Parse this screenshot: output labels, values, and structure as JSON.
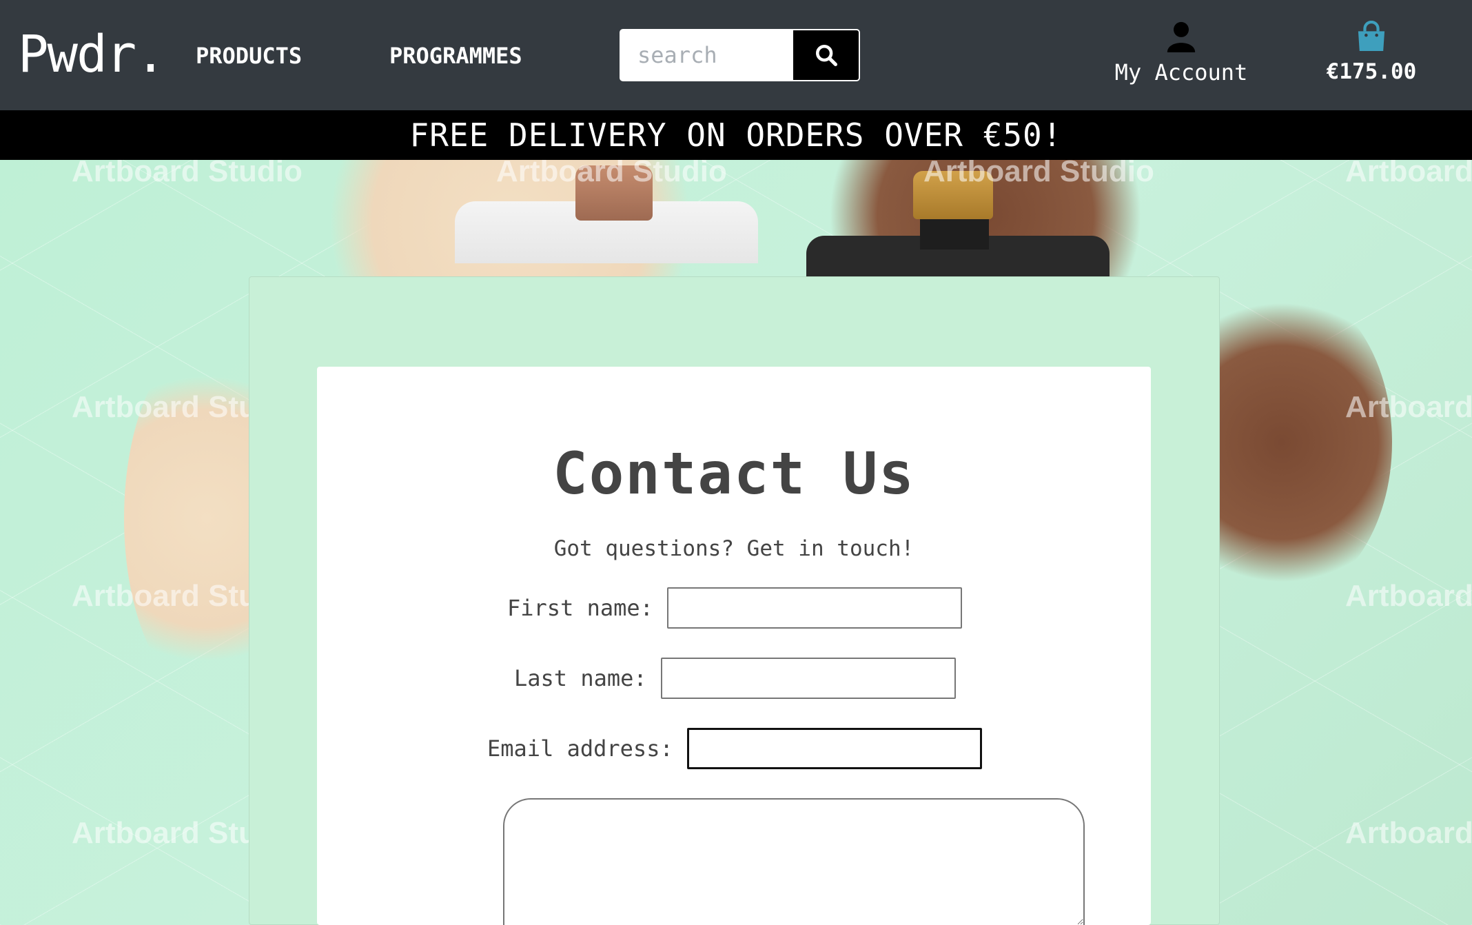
{
  "navbar": {
    "logo": "Pwdr.",
    "links": [
      "PRODUCTS",
      "PROGRAMMES"
    ],
    "search_placeholder": "search",
    "account_label": "My Account",
    "bag_total": "€175.00",
    "bag_color": "#3e9fbd"
  },
  "banner": {
    "text": "FREE DELIVERY ON ORDERS OVER €50!"
  },
  "hero": {
    "watermark": "Artboard Studio"
  },
  "contact": {
    "title": "Contact Us",
    "subtitle": "Got questions? Get in touch!",
    "fields": [
      {
        "label": "First name:",
        "value": ""
      },
      {
        "label": "Last name:",
        "value": ""
      },
      {
        "label": "Email address:",
        "value": ""
      }
    ],
    "message_value": ""
  }
}
